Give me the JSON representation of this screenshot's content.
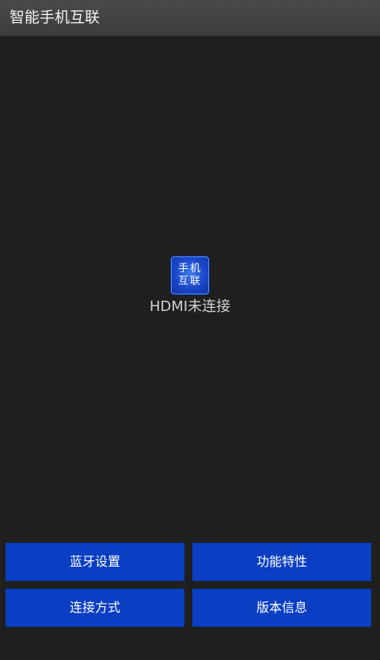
{
  "app": {
    "title": "智能手机互联",
    "icon_name": "phone-link-app-icon",
    "icon_text_line1": "手机",
    "icon_text_line2": "互联",
    "status": "HDMI未连接"
  },
  "buttons": {
    "bluetooth": "蓝牙设置",
    "features": "功能特性",
    "connection": "连接方式",
    "version": "版本信息"
  },
  "colors": {
    "background": "#1f1f1f",
    "titlebar": "#434343",
    "button": "#0a3fc4",
    "icon": "#1a46c9"
  }
}
